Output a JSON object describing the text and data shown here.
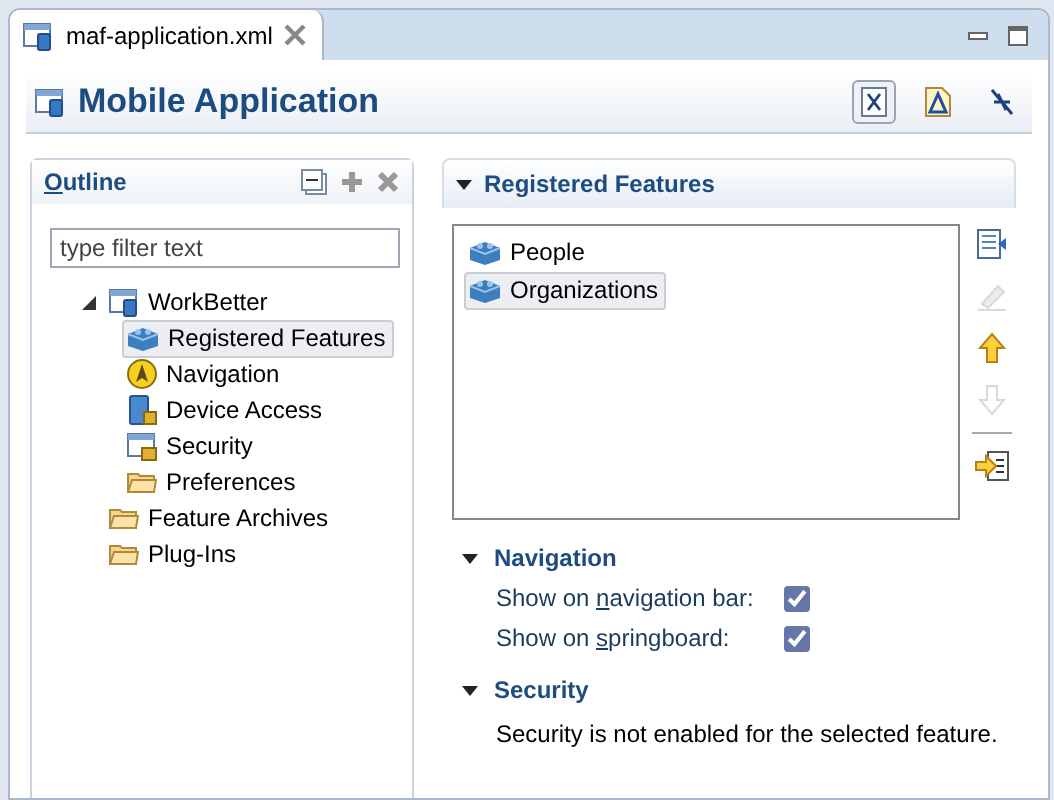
{
  "editor_tab": {
    "title": "maf-application.xml"
  },
  "header": {
    "title": "Mobile Application",
    "toolbar": [
      {
        "kind": "xml",
        "pressed": true
      },
      {
        "kind": "adf",
        "pressed": false
      },
      {
        "kind": "deploy",
        "pressed": false
      }
    ]
  },
  "outline": {
    "title": {
      "key": "O",
      "post": "utline"
    },
    "filter": {
      "placeholder": "type filter text"
    },
    "tree": [
      {
        "label": "WorkBetter",
        "kind": "app",
        "expanded": true,
        "selected": false,
        "children": [
          {
            "label": "Registered Features",
            "kind": "feature",
            "selected": true
          },
          {
            "label": "Navigation",
            "kind": "compass",
            "selected": false
          },
          {
            "label": "Device Access",
            "kind": "device",
            "selected": false
          },
          {
            "label": "Security",
            "kind": "lock",
            "selected": false
          },
          {
            "label": "Preferences",
            "kind": "folder",
            "selected": false
          }
        ]
      },
      {
        "label": "Feature Archives",
        "kind": "folder",
        "selected": false
      },
      {
        "label": "Plug-Ins",
        "kind": "folder",
        "selected": false
      }
    ]
  },
  "registered_features": {
    "title": "Registered Features",
    "expanded": true,
    "items": [
      {
        "label": "People",
        "selected": false
      },
      {
        "label": "Organizations",
        "selected": true
      }
    ],
    "actions": [
      {
        "kind": "add",
        "disabled": false
      },
      {
        "kind": "edit",
        "disabled": true
      },
      {
        "kind": "up",
        "disabled": false
      },
      {
        "kind": "down",
        "disabled": true
      },
      {
        "kind": "separator"
      },
      {
        "kind": "import",
        "disabled": false
      }
    ]
  },
  "navigation": {
    "title": "Navigation",
    "expanded": true,
    "options": [
      {
        "label": {
          "pre": "Show on ",
          "key": "n",
          "post": "avigation bar:"
        },
        "checked": true
      },
      {
        "label": {
          "pre": "Show on ",
          "key": "s",
          "post": "pringboard:"
        },
        "checked": true
      }
    ]
  },
  "security": {
    "title": "Security",
    "expanded": true,
    "message": "Security is not enabled for the selected feature."
  }
}
